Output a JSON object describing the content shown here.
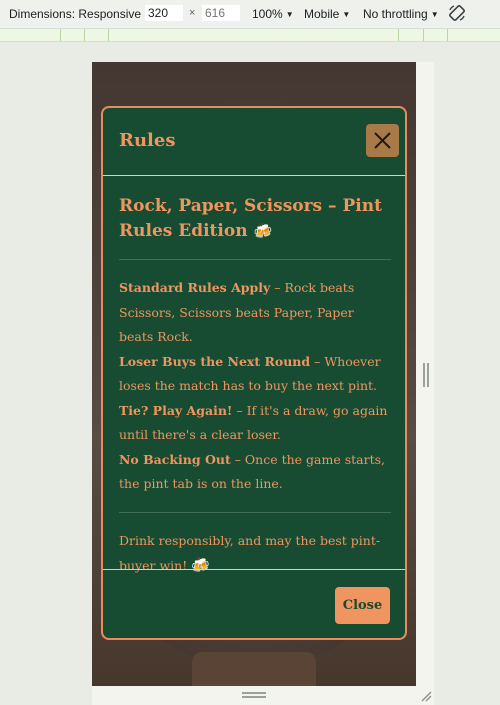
{
  "devtools": {
    "dimensions_label": "Dimensions: Responsive",
    "width_value": "320",
    "height_placeholder": "616",
    "times_sign": "×",
    "zoom_label": "100%",
    "device_label": "Mobile",
    "throttling_label": "No throttling",
    "caret": "▼"
  },
  "modal": {
    "title": "Rules",
    "heading": "Rock, Paper, Scissors – Pint Rules Edition",
    "heading_emoji": "🍻",
    "rules": [
      {
        "name": "Standard Rules Apply",
        "text": " – Rock beats Scissors, Scissors beats Paper, Paper beats Rock."
      },
      {
        "name": "Loser Buys the Next Round",
        "text": " – Whoever loses the match has to buy the next pint."
      },
      {
        "name": "Tie? Play Again!",
        "text": " – If it's a draw, go again until there's a clear loser."
      },
      {
        "name": "No Backing Out",
        "text": " – Once the game starts, the pint tab is on the line."
      }
    ],
    "closing_note": "Drink responsibly, and may the best pint-buyer win!",
    "closing_emoji": "🍻",
    "close_button_label": "Close"
  },
  "colors": {
    "modal_bg": "#174c33",
    "accent": "#f0955f",
    "close_x_bg": "#a87a48",
    "devtools_bg": "#eef1ec"
  },
  "icons": {
    "close": "close-icon",
    "rotate": "rotate-icon"
  }
}
